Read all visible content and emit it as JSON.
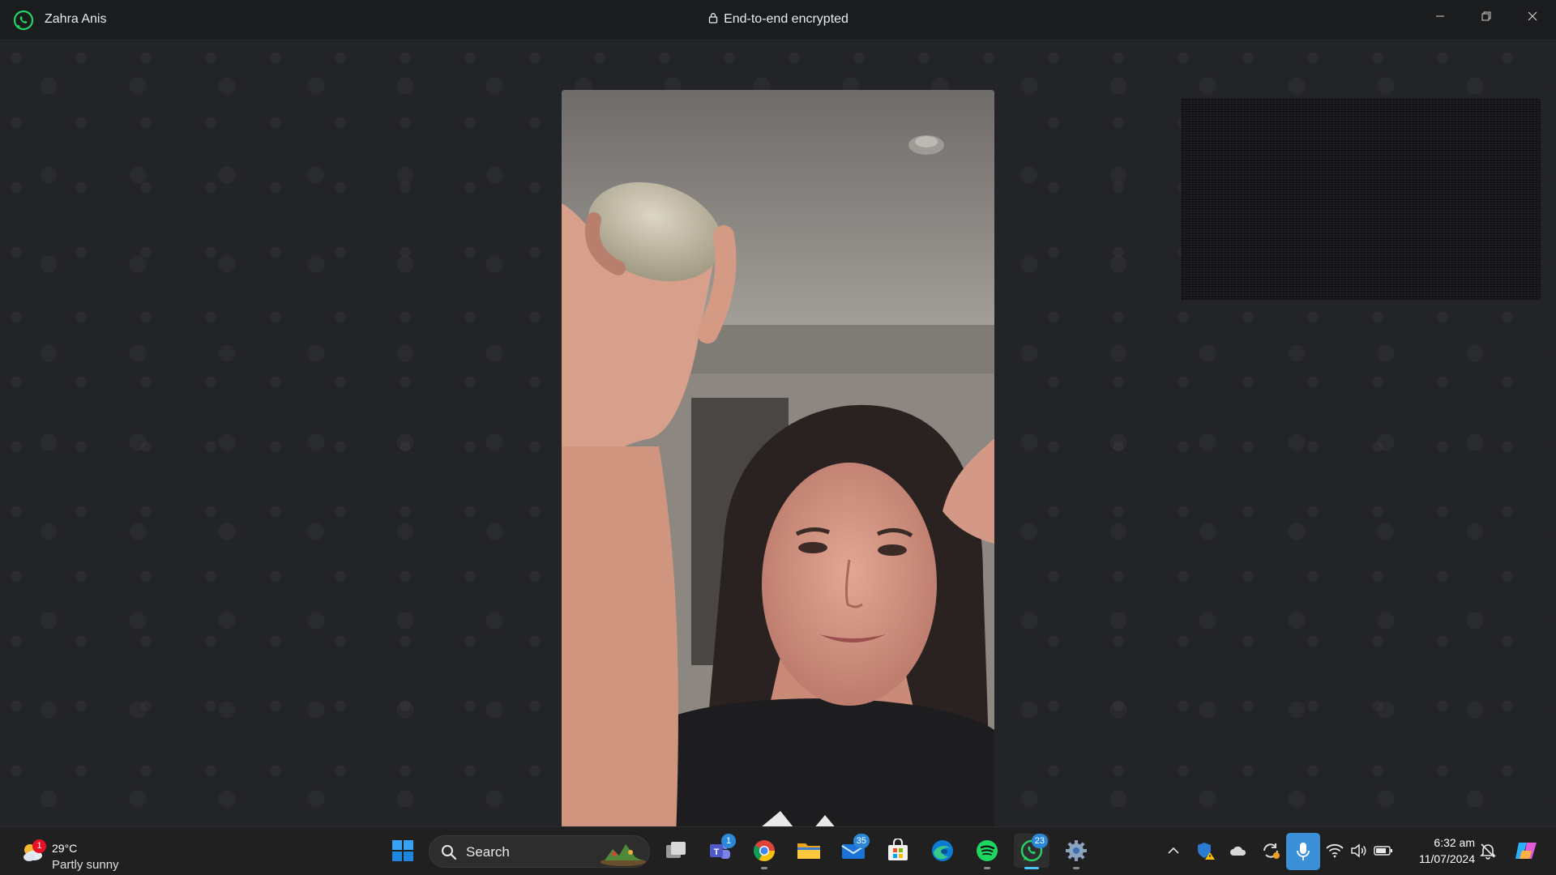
{
  "window": {
    "contact_name": "Zahra Anis",
    "encryption_label": "End-to-end encrypted"
  },
  "taskbar": {
    "weather": {
      "temperature": "29°C",
      "condition": "Partly sunny",
      "badge": "1"
    },
    "search": {
      "label": "Search"
    },
    "apps": [
      {
        "name": "Start",
        "icon": "windows-start-icon"
      },
      {
        "name": "Task View",
        "icon": "task-view-icon"
      },
      {
        "name": "Microsoft Teams",
        "icon": "teams-icon",
        "badge": "1"
      },
      {
        "name": "Google Chrome",
        "icon": "chrome-icon"
      },
      {
        "name": "File Explorer",
        "icon": "folder-icon"
      },
      {
        "name": "Mail",
        "icon": "mail-icon",
        "badge": "35"
      },
      {
        "name": "Microsoft Store",
        "icon": "store-icon"
      },
      {
        "name": "Microsoft Edge",
        "icon": "edge-icon"
      },
      {
        "name": "Spotify",
        "icon": "spotify-icon"
      },
      {
        "name": "WhatsApp",
        "icon": "whatsapp-icon",
        "badge": "23"
      },
      {
        "name": "Settings",
        "icon": "settings-icon"
      }
    ],
    "tray": {
      "time": "6:32 am",
      "date": "11/07/2024"
    }
  },
  "colors": {
    "whatsapp_green": "#25d366",
    "accent_blue": "#3b8fd6",
    "background": "#232427"
  }
}
